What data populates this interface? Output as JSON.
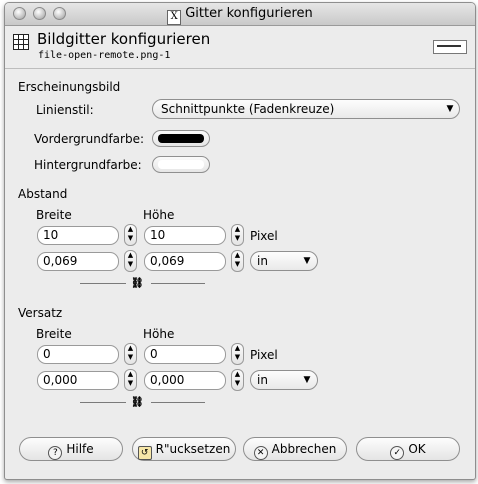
{
  "window": {
    "title": "Gitter konfigurieren"
  },
  "header": {
    "title": "Bildgitter konfigurieren",
    "subtitle": "file-open-remote.png-1"
  },
  "appearance": {
    "section": "Erscheinungsbild",
    "linestyle_label": "Linienstil:",
    "linestyle_value": "Schnittpunkte (Fadenkreuze)",
    "fg_label": "Vordergrundfarbe:",
    "fg_color": "#000000",
    "bg_label": "Hintergrundfarbe:",
    "bg_color": "#ffffff"
  },
  "spacing": {
    "section": "Abstand",
    "width_label": "Breite",
    "height_label": "Höhe",
    "px_width": "10",
    "px_height": "10",
    "px_unit": "Pixel",
    "in_width": "0,069",
    "in_height": "0,069",
    "unit": "in"
  },
  "offset": {
    "section": "Versatz",
    "width_label": "Breite",
    "height_label": "Höhe",
    "px_width": "0",
    "px_height": "0",
    "px_unit": "Pixel",
    "in_width": "0,000",
    "in_height": "0,000",
    "unit": "in"
  },
  "buttons": {
    "help": "Hilfe",
    "reset": "R\"ucksetzen",
    "cancel": "Abbrechen",
    "ok": "OK"
  },
  "icons": {
    "x_icon": "X",
    "grid_icon": "grid-icon",
    "chain_icon": "chain-icon"
  }
}
